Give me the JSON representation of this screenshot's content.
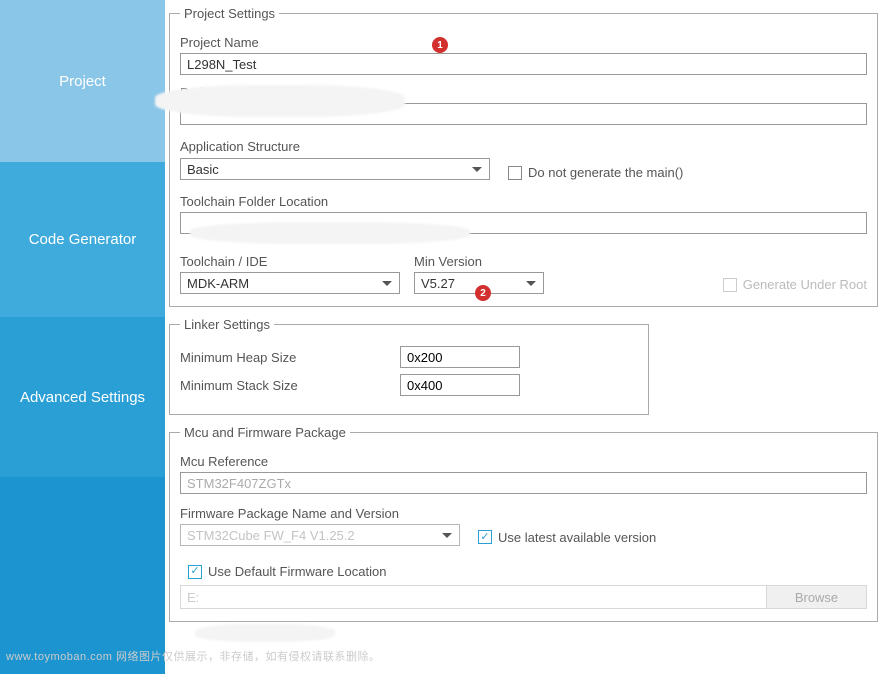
{
  "sidebar": {
    "project": "Project",
    "code_generator": "Code Generator",
    "advanced_settings": "Advanced Settings"
  },
  "project_settings": {
    "legend": "Project Settings",
    "project_name_label": "Project Name",
    "project_name_value": "L298N_Test",
    "project_location_label": "Project Location",
    "project_location_value": "",
    "app_structure_label": "Application Structure",
    "app_structure_value": "Basic",
    "do_not_generate_main_label": "Do not generate the main()",
    "do_not_generate_main_checked": false,
    "toolchain_folder_label": "Toolchain Folder Location",
    "toolchain_folder_value": "",
    "toolchain_ide_label": "Toolchain / IDE",
    "toolchain_ide_value": "MDK-ARM",
    "min_version_label": "Min Version",
    "min_version_value": "V5.27",
    "generate_under_root_label": "Generate Under Root",
    "generate_under_root_checked": false
  },
  "linker_settings": {
    "legend": "Linker Settings",
    "min_heap_label": "Minimum Heap Size",
    "min_heap_value": "0x200",
    "min_stack_label": "Minimum Stack Size",
    "min_stack_value": "0x400"
  },
  "mcu_firmware": {
    "legend": "Mcu and Firmware Package",
    "mcu_ref_label": "Mcu Reference",
    "mcu_ref_value": "STM32F407ZGTx",
    "fw_name_label": "Firmware Package Name and Version",
    "fw_name_value": "STM32Cube FW_F4 V1.25.2",
    "use_latest_label": "Use latest available version",
    "use_latest_checked": true,
    "use_default_loc_label": "Use Default Firmware Location",
    "use_default_loc_checked": true,
    "fw_location_value": "E:",
    "browse_label": "Browse"
  },
  "badges": {
    "one": "1",
    "two": "2"
  },
  "watermark": "www.toymoban.com  网络图片仅供展示，非存储，如有侵权请联系删除。"
}
